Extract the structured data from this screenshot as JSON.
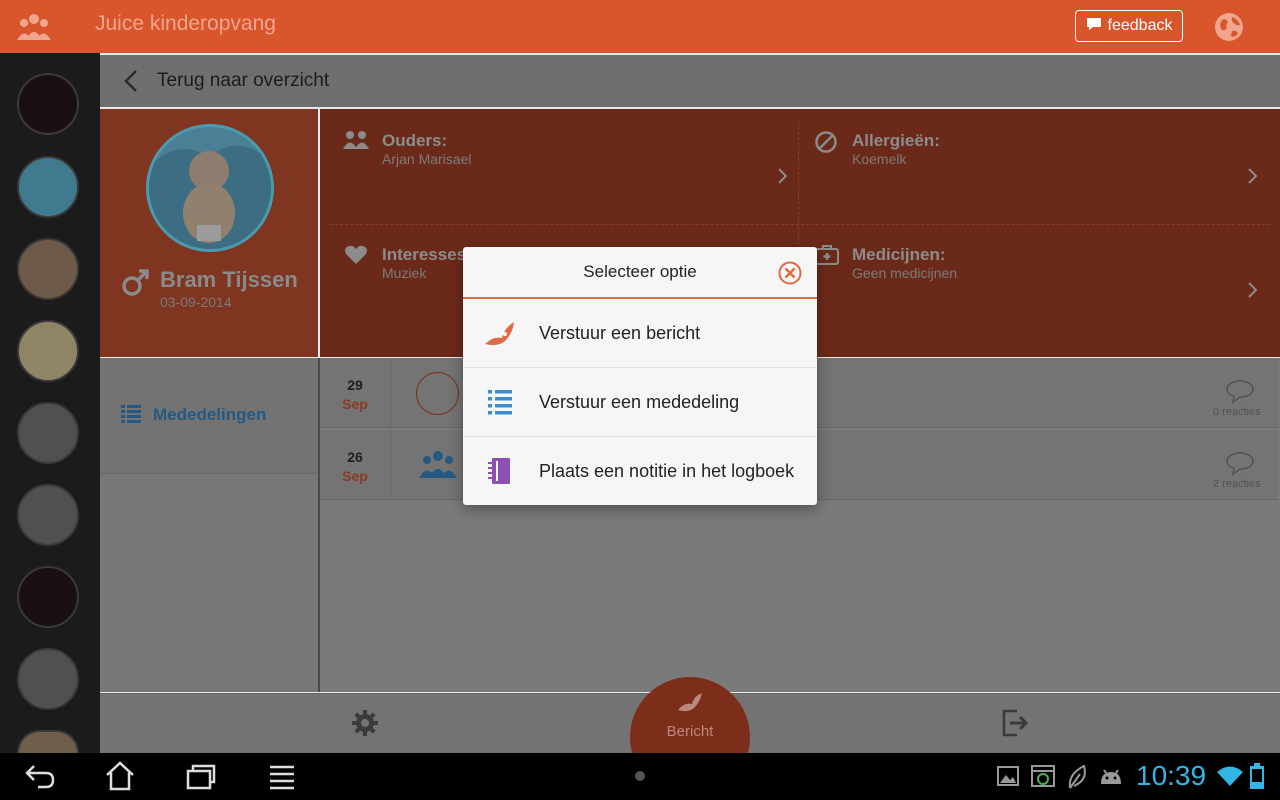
{
  "app": {
    "title": "Juice kinderopvang",
    "feedback_label": "feedback"
  },
  "backbar": {
    "label": "Terug naar overzicht"
  },
  "profile": {
    "name": "Bram Tijssen",
    "dob": "03-09-2014",
    "gender_symbol": "♂"
  },
  "info": {
    "parents": {
      "title": "Ouders:",
      "value": "Arjan Marisael"
    },
    "allergies": {
      "title": "Allergieën:",
      "value": "Koemelk"
    },
    "interests": {
      "title": "Interesses",
      "value": "Muziek"
    },
    "medicines": {
      "title": "Medicijnen:",
      "value": "Geen medicijnen"
    }
  },
  "sidebar": {
    "section_label": "Mededelingen"
  },
  "feed": {
    "rows": [
      {
        "day": "29",
        "month": "Sep",
        "reactions": "0 reacties"
      },
      {
        "day": "26",
        "month": "Sep",
        "reactions": "2 reacties"
      }
    ]
  },
  "bottom": {
    "fab_label": "Bericht"
  },
  "modal": {
    "title": "Selecteer optie",
    "options": [
      {
        "label": "Verstuur een bericht",
        "icon": "bird-icon"
      },
      {
        "label": "Verstuur een mededeling",
        "icon": "list-icon"
      },
      {
        "label": "Plaats een notitie in het logboek",
        "icon": "notebook-icon"
      }
    ]
  },
  "system": {
    "clock": "10:39"
  },
  "colors": {
    "brand": "#d9552b",
    "accent_blue": "#33b5e5",
    "notebook_purple": "#8e4fb3",
    "list_blue": "#3a8fd0"
  }
}
